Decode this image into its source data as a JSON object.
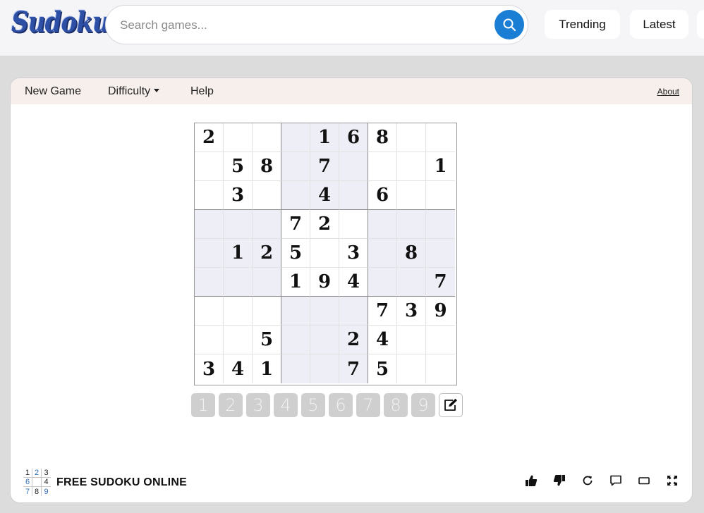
{
  "header": {
    "logo_text": "Sudoku",
    "search": {
      "placeholder": "Search games..."
    },
    "nav": {
      "trending_label": "Trending",
      "latest_label": "Latest"
    }
  },
  "game_menu": {
    "new_game_label": "New Game",
    "difficulty_label": "Difficulty",
    "help_label": "Help",
    "about_label": "About"
  },
  "board": {
    "rows": [
      [
        "2",
        "",
        "",
        "",
        "1",
        "6",
        "8",
        "",
        ""
      ],
      [
        "",
        "5",
        "8",
        "",
        "7",
        "",
        "",
        "",
        "1"
      ],
      [
        "",
        "3",
        "",
        "",
        "4",
        "",
        "6",
        "",
        ""
      ],
      [
        "",
        "",
        "",
        "7",
        "2",
        "",
        "",
        "",
        ""
      ],
      [
        "",
        "1",
        "2",
        "5",
        "",
        "3",
        "",
        "8",
        ""
      ],
      [
        "",
        "",
        "",
        "1",
        "9",
        "4",
        "",
        "",
        "7"
      ],
      [
        "",
        "",
        "",
        "",
        "",
        "",
        "7",
        "3",
        "9"
      ],
      [
        "",
        "",
        "5",
        "",
        "",
        "2",
        "4",
        "",
        ""
      ],
      [
        "3",
        "4",
        "1",
        "",
        "",
        "7",
        "5",
        "",
        ""
      ]
    ]
  },
  "numpad": {
    "labels": [
      "1",
      "2",
      "3",
      "4",
      "5",
      "6",
      "7",
      "8",
      "9"
    ]
  },
  "footer": {
    "mini_logo": [
      "1",
      "2",
      "3",
      "6",
      "",
      "4",
      "7",
      "8",
      "9"
    ],
    "title": "FREE SUDOKU ONLINE"
  },
  "colors": {
    "accent": "#1a7fd4",
    "logo": "#2d4fa6",
    "menubar_bg": "#f7efec",
    "shaded_box": "#eeeef7",
    "numpad_bg": "#cfcfcf",
    "mini_logo_blue": "#2f6fb8"
  },
  "icons": [
    "search-icon",
    "pencil-edit-icon",
    "thumbs-up-icon",
    "thumbs-down-icon",
    "reload-icon",
    "comment-icon",
    "theater-mode-icon",
    "fullscreen-icon"
  ]
}
